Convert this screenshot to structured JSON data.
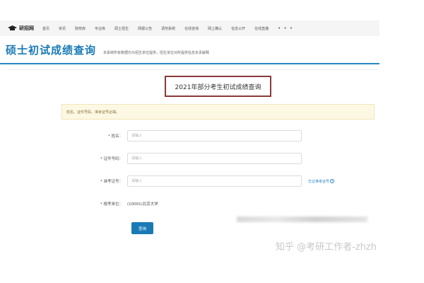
{
  "topnav": {
    "logo_text": "研招网",
    "items": [
      "首页",
      "资讯",
      "院校库",
      "专业库",
      "硕士招生",
      "网报公告",
      "调剂系统",
      "在线咨询",
      "网上确认",
      "信息公开",
      "在线直播"
    ],
    "more": "• • •"
  },
  "header": {
    "title": "硕士初试成绩查询",
    "subtitle": "本系统所有数据均为招生单位提供，招生单位对所提供信息负责解释"
  },
  "panel": {
    "heading": "2021年部分考生初试成绩查询"
  },
  "notice": {
    "text": "姓名、证件号码、准考证号必填。"
  },
  "form": {
    "name_label": "* 姓名：",
    "name_placeholder": "请输入",
    "id_label": "* 证件号码：",
    "id_placeholder": "请输入",
    "exam_label": "* 准考证号：",
    "exam_placeholder": "请输入",
    "forgot_exam_link": "忘记准考证号",
    "school_label": "* 报考单位：",
    "school_value": "(10001)北京大学",
    "submit_label": "查询"
  },
  "watermark": "知乎 @考研工作者-zhzh",
  "colors": {
    "brand_blue": "#1a7ab6",
    "heading_border": "#8b3a3a",
    "notice_bg": "#fcf8e3"
  }
}
